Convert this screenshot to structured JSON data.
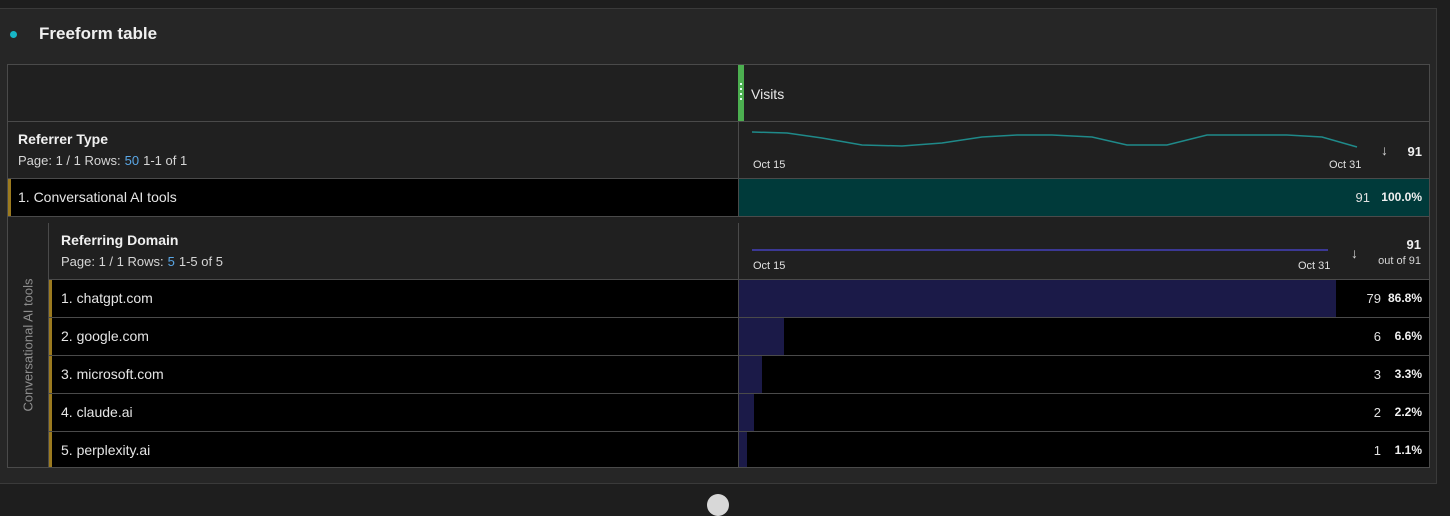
{
  "panel": {
    "title": "Freeform table"
  },
  "table": {
    "metric": "Visits",
    "dimension": {
      "title": "Referrer Type",
      "page_label": "Page: 1 / 1  Rows:",
      "rows_value": "50",
      "range": "1-1 of 1",
      "spark_start": "Oct 15",
      "spark_end": "Oct 31",
      "total": "91",
      "sort_icon": "arrow-down-icon"
    },
    "rows": [
      {
        "label": "1.  Conversational AI tools",
        "value": "91",
        "percent": "100.0%",
        "fraction": 1.0
      }
    ],
    "breakdown": {
      "side_label": "Conversational AI tools",
      "title": "Referring Domain",
      "page_label": "Page: 1 / 1  Rows:",
      "rows_value": "5",
      "range": "1-5 of 5",
      "spark_start": "Oct 15",
      "spark_end": "Oct 31",
      "total": "91",
      "total_sub": "out of 91",
      "rows": [
        {
          "label": "1.  chatgpt.com",
          "value": "79",
          "percent": "86.8%",
          "fraction": 0.868
        },
        {
          "label": "2.  google.com",
          "value": "6",
          "percent": "6.6%",
          "fraction": 0.066
        },
        {
          "label": "3.  microsoft.com",
          "value": "3",
          "percent": "3.3%",
          "fraction": 0.033
        },
        {
          "label": "4.  claude.ai",
          "value": "2",
          "percent": "2.2%",
          "fraction": 0.022
        },
        {
          "label": "5.  perplexity.ai",
          "value": "1",
          "percent": "1.1%",
          "fraction": 0.011
        }
      ]
    }
  },
  "colors": {
    "accent_dot": "#17b6c6",
    "column_grip": "#4caf50",
    "top_bar": "#003a3a",
    "breakdown_bar": "#1b1a48",
    "row_accent": "#9b7a1f",
    "link": "#5aa7e6"
  }
}
